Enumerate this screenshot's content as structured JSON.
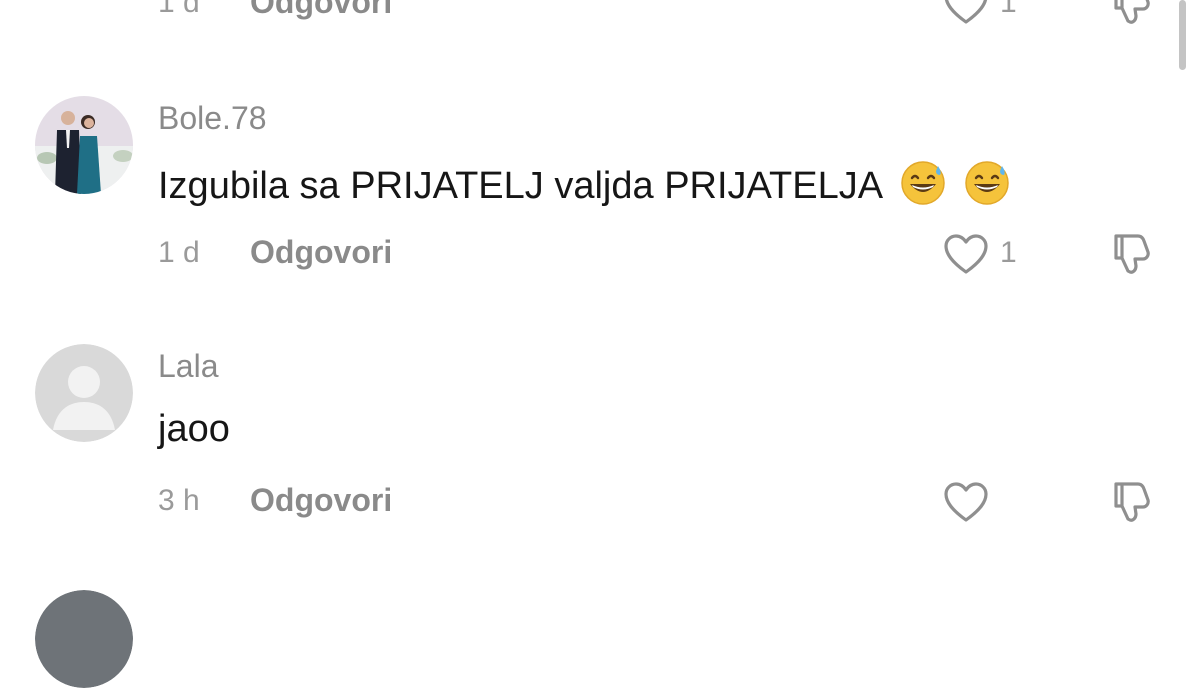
{
  "comments": [
    {
      "time": "1 d",
      "reply": "Odgovori",
      "likes": "1"
    },
    {
      "username": "Bole.78",
      "text": "Izgubila sa PRIJATELJ valjda PRIJATELJA",
      "emoji_icon": "grinning-sweat-emoji-icon",
      "emoji_count": 2,
      "time": "1 d",
      "reply": "Odgovori",
      "likes": "1"
    },
    {
      "username": "Lala",
      "text": "jaoo",
      "time": "3 h",
      "reply": "Odgovori",
      "likes": ""
    }
  ],
  "colors": {
    "text": "#161616",
    "secondary": "#8a8a8a",
    "icon": "#8f8f8f",
    "emoji_face": "#f5c33b"
  }
}
